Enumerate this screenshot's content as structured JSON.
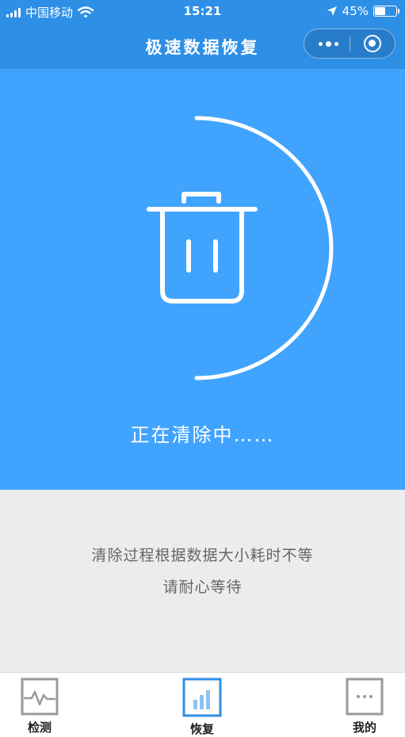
{
  "status_bar": {
    "carrier": "中国移动",
    "time": "15:21",
    "battery": "45%",
    "icons": [
      "signal-icon",
      "wifi-icon",
      "location-icon",
      "battery-icon"
    ]
  },
  "nav": {
    "title": "极速数据恢复",
    "icons": [
      "more-icon",
      "close-miniprogram-icon"
    ]
  },
  "hero": {
    "status_text": "正在清除中……",
    "icon": "trash-icon",
    "background": "#40a4ff"
  },
  "info": {
    "line1": "清除过程根据数据大小耗时不等",
    "line2": "请耐心等待"
  },
  "tabs": [
    {
      "label": "检测",
      "icon": "pulse-icon",
      "active": false
    },
    {
      "label": "恢复",
      "icon": "bar-chart-icon",
      "active": true
    },
    {
      "label": "我的",
      "icon": "ellipsis-icon",
      "active": false
    }
  ],
  "colors": {
    "brand": "#2e8fe6",
    "hero": "#40a4ff",
    "active_tab": "#2e8fe6",
    "inactive_tab": "#9a9a9a"
  }
}
